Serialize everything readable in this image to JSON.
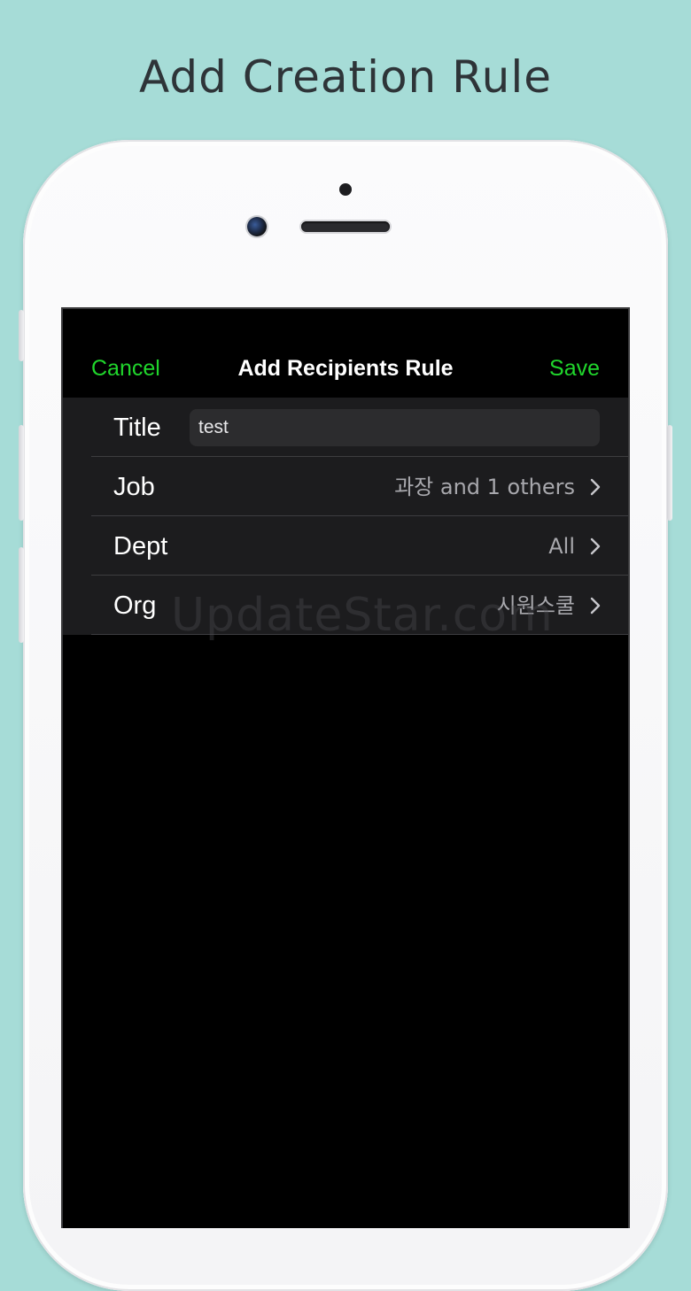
{
  "promo": {
    "headline": "Add Creation Rule"
  },
  "nav": {
    "cancel_label": "Cancel",
    "title": "Add Recipients Rule",
    "save_label": "Save"
  },
  "form": {
    "title_label": "Title",
    "title_value": "test",
    "rows": [
      {
        "label": "Job",
        "value": "과장 and 1 others"
      },
      {
        "label": "Dept",
        "value": "All"
      },
      {
        "label": "Org",
        "value": "시원스쿨"
      }
    ]
  },
  "watermark": "UpdateStar.com",
  "colors": {
    "background": "#a6dcd7",
    "accent": "#20d62c",
    "screen": "#000000",
    "cell": "#1c1c1e"
  },
  "icons": {
    "disclosure": "chevron-right-icon"
  }
}
